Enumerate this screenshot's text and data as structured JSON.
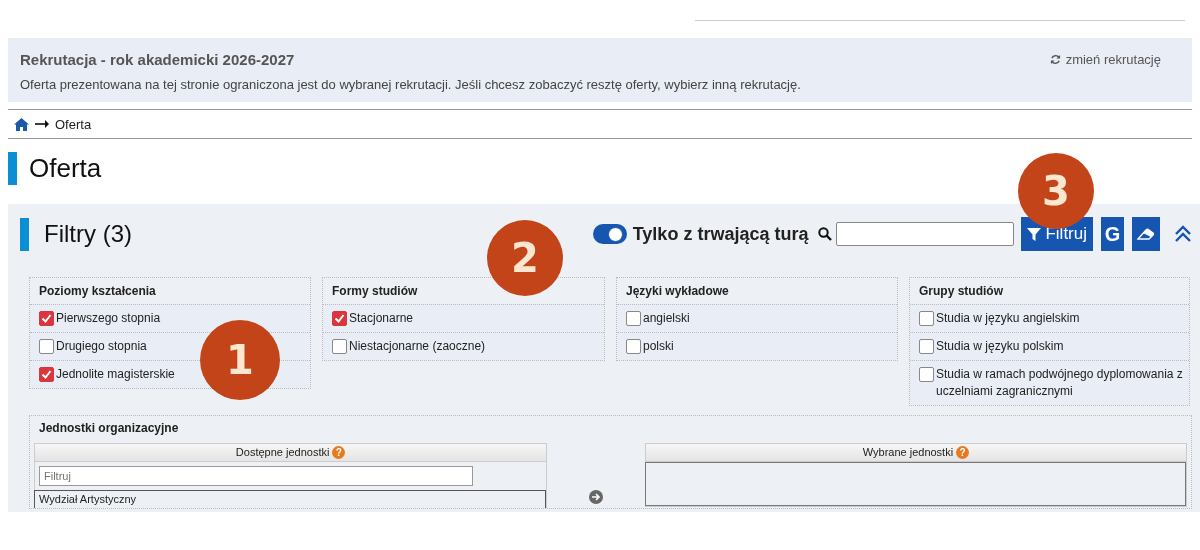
{
  "recruitment": {
    "title": "Rekrutacja - rok akademicki 2026-2027",
    "change_link": "zmień rekrutację",
    "message": "Oferta prezentowana na tej stronie ograniczona jest do wybranej rekrutacji. Jeśli chcesz zobaczyć resztę oferty, wybierz inną rekrutację."
  },
  "breadcrumb": {
    "current": "Oferta"
  },
  "page_title": "Oferta",
  "filters": {
    "title": "Filtry (3)",
    "ongoing_toggle": {
      "label": "Tylko z trwającą turą",
      "on": true
    },
    "filter_button": "Filtruj",
    "g_button": "G",
    "groups": [
      {
        "title": "Poziomy kształcenia",
        "options": [
          {
            "label": "Pierwszego stopnia",
            "checked": true
          },
          {
            "label": "Drugiego stopnia",
            "checked": false
          },
          {
            "label": "Jednolite magisterskie",
            "checked": true
          }
        ]
      },
      {
        "title": "Formy studiów",
        "options": [
          {
            "label": "Stacjonarne",
            "checked": true
          },
          {
            "label": "Niestacjonarne (zaoczne)",
            "checked": false
          }
        ]
      },
      {
        "title": "Języki wykładowe",
        "options": [
          {
            "label": "angielski",
            "checked": false
          },
          {
            "label": "polski",
            "checked": false
          }
        ]
      },
      {
        "title": "Grupy studiów",
        "options": [
          {
            "label": "Studia w języku angielskim",
            "checked": false
          },
          {
            "label": "Studia w języku polskim",
            "checked": false
          },
          {
            "label": "Studia w ramach podwójnego dyplomowania z uczelniami zagranicznymi",
            "checked": false
          }
        ]
      }
    ],
    "units": {
      "title": "Jednostki organizacyjne",
      "available": {
        "title": "Dostępne jednostki",
        "help": "?",
        "placeholder": "Filtruj",
        "items": [
          "Wydział Artystyczny"
        ]
      },
      "selected": {
        "title": "Wybrane jednostki",
        "help": "?"
      }
    }
  },
  "annotations": [
    "1",
    "2",
    "3"
  ]
}
